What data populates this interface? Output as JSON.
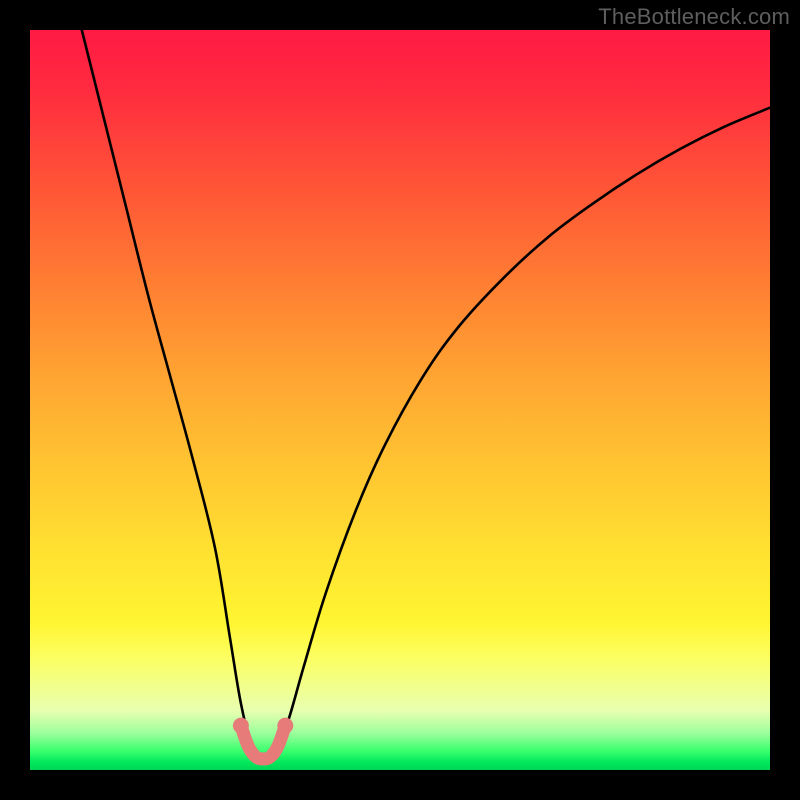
{
  "watermark": "TheBottleneck.com",
  "chart_data": {
    "type": "line",
    "title": "",
    "xlabel": "",
    "ylabel": "",
    "xlim": [
      0,
      100
    ],
    "ylim": [
      0,
      100
    ],
    "series": [
      {
        "name": "bottleneck-curve",
        "x": [
          7,
          10,
          13,
          16,
          19,
          22,
          25,
          27,
          28.5,
          30,
          31,
          32,
          33.5,
          35,
          37,
          40,
          44,
          48,
          53,
          58,
          64,
          70,
          76,
          82,
          88,
          94,
          100
        ],
        "values": [
          100,
          88,
          76,
          64,
          53,
          42,
          30,
          18,
          9,
          3,
          1.5,
          1.5,
          3,
          7,
          14,
          24,
          35,
          44,
          53,
          60,
          66.5,
          72,
          76.5,
          80.5,
          84,
          87,
          89.5
        ]
      }
    ],
    "bottom_arc": {
      "name": "highlight-arc",
      "color": "#e77b7a",
      "x": [
        28.5,
        29.5,
        30.5,
        31.5,
        32.5,
        33.5,
        34.5
      ],
      "values": [
        6,
        3.2,
        1.8,
        1.5,
        1.8,
        3.2,
        6
      ]
    },
    "background_gradient": {
      "top_color": "#ff1a44",
      "mid_color": "#ffe031",
      "bottom_color": "#00d455"
    }
  }
}
